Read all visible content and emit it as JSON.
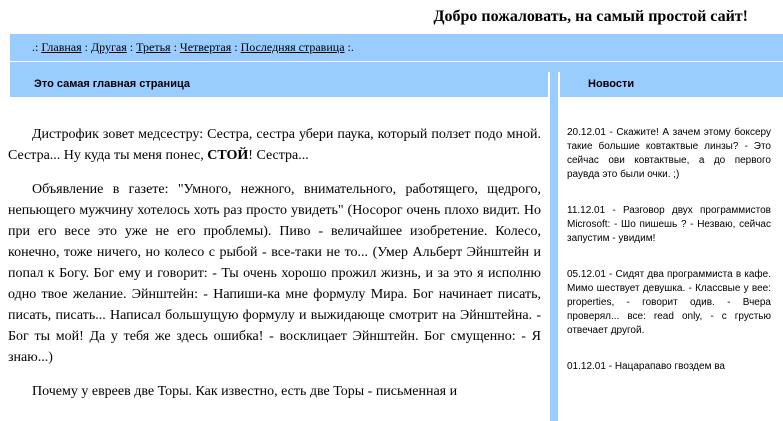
{
  "site": {
    "title": "Добро пожаловать, на самый простой сайт!"
  },
  "nav": {
    "prefix": ".:",
    "suffix": ":.",
    "separator": ":",
    "links": [
      "Главная",
      "Другая",
      "Третья",
      "Четвертая",
      "Последняя стравица"
    ]
  },
  "main": {
    "heading": "Это самая главная страница",
    "paragraphs": [
      {
        "before": "Дистрофик зовет медсестру: Сестра, сестра убери паука, который ползет подо мной. Сестра... Ну куда ты меня понес, ",
        "bold": "СТОЙ",
        "after": "! Сестра..."
      },
      {
        "before": "Объявление в газете: \"Умного, нежного, внимательного, работящего, щедрого, непьющего мужчину хотелось хоть раз просто увидеть\" (Носорог очень плохо видит. Но при его весе это уже не его проблемы). Пиво - величайшее изобретение. Колесо, конечно, тоже ничего, но колесо с рыбой - все-таки не то... (Умер Альберт Эйнштейн и попал к Богу. Бог ему и говорит: - Ты очень хорошо прожил жизнь, и за это я исполню одно твое желание. Эйнштейн: - Напиши-ка мне формулу Мира. Бог начинает писать, писать, писать... Написал большущую формулу и выжидающе смотрит на Эйнштейна. - Бог ты мой! Да у тебя же здесь ошибка! - восклицает Эйнштейн. Бог смущенно: - Я знаю...)",
        "bold": "",
        "after": ""
      },
      {
        "before": "Почему у евреев две Торы. Как известно, есть две Торы - письменная и",
        "bold": "",
        "after": ""
      }
    ]
  },
  "news": {
    "heading": "Новости",
    "items": [
      "20.12.01 - Скажите! А зачем этому боксеру такие большие ковтактвые линзы? - Это сейчас ови ковтактвые, а до первого раувда это были очки. ;)",
      "11.12.01 - Разговор двух программистов Microsoft: - Шо пишешь ? - Незваю, сейчас запустим - увидим!",
      "05.12.01 - Сидят два программиста в кафе. Мимо шествует девушка. - Классвые у вее: properties, - говорит одив. - Вчера проверял... все: read only, - с грустью отвечает другой.",
      "01.12.01 - Нацарапаво гвоздем ва"
    ]
  }
}
